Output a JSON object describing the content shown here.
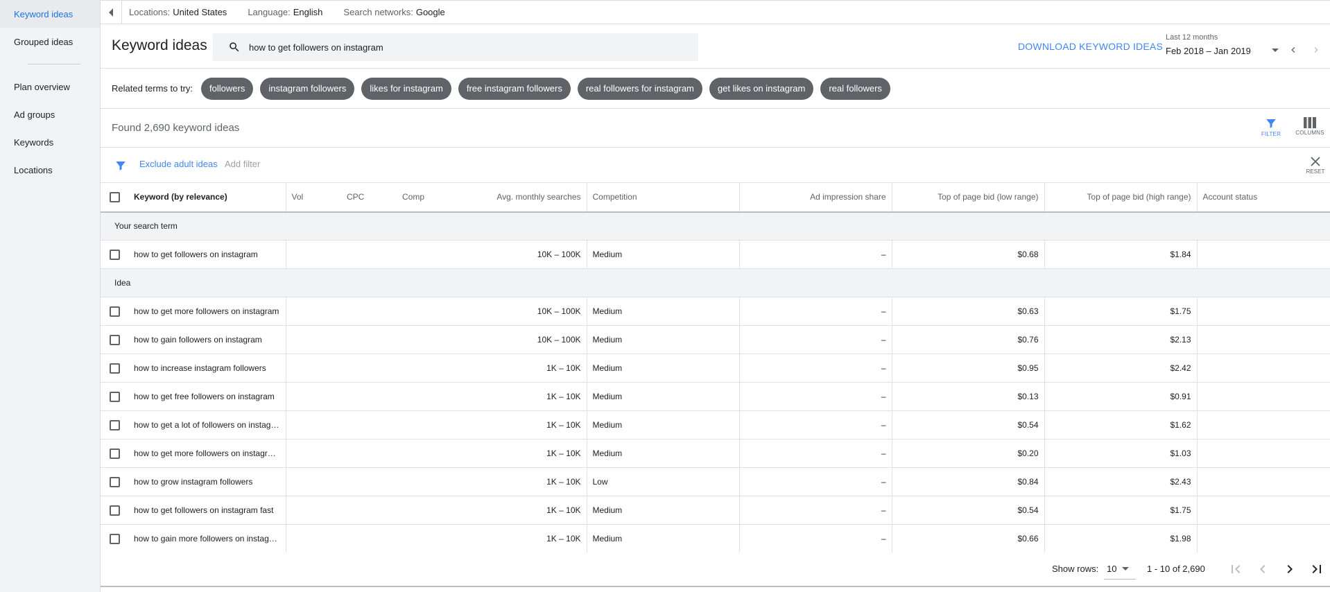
{
  "sidebar": {
    "items": [
      {
        "label": "Keyword ideas",
        "active": true
      },
      {
        "label": "Grouped ideas",
        "active": false
      },
      {
        "label": "Plan overview",
        "active": false
      },
      {
        "label": "Ad groups",
        "active": false
      },
      {
        "label": "Keywords",
        "active": false
      },
      {
        "label": "Locations",
        "active": false
      }
    ]
  },
  "topbar": {
    "locations_label": "Locations:",
    "locations_value": "United States",
    "language_label": "Language:",
    "language_value": "English",
    "networks_label": "Search networks:",
    "networks_value": "Google"
  },
  "header": {
    "title": "Keyword ideas",
    "search_value": "how to get followers on instagram",
    "download_label": "DOWNLOAD KEYWORD IDEAS",
    "date_range_label": "Last 12 months",
    "date_range_value": "Feb 2018 – Jan 2019"
  },
  "related": {
    "label": "Related terms to try:",
    "chips": [
      "followers",
      "instagram followers",
      "likes for instagram",
      "free instagram followers",
      "real followers for instagram",
      "get likes on instagram",
      "real followers"
    ]
  },
  "results": {
    "found_text": "Found 2,690 keyword ideas",
    "filter_label": "FILTER",
    "columns_label": "COLUMNS",
    "exclude_label": "Exclude adult ideas",
    "add_filter_label": "Add filter",
    "reset_label": "RESET"
  },
  "table": {
    "headers": {
      "keyword": "Keyword (by relevance)",
      "vol": "Vol",
      "cpc": "CPC",
      "comp": "Comp",
      "avg": "Avg. monthly searches",
      "competition": "Competition",
      "impression": "Ad impression share",
      "low_bid": "Top of page bid (low range)",
      "high_bid": "Top of page bid (high range)",
      "status": "Account status"
    },
    "section_search_term": "Your search term",
    "section_idea": "Idea",
    "search_term_row": {
      "keyword": "how to get followers on instagram",
      "avg": "10K – 100K",
      "competition": "Medium",
      "impression": "–",
      "low": "$0.68",
      "high": "$1.84"
    },
    "rows": [
      {
        "keyword": "how to get more followers on instagram",
        "avg": "10K – 100K",
        "competition": "Medium",
        "impression": "–",
        "low": "$0.63",
        "high": "$1.75"
      },
      {
        "keyword": "how to gain followers on instagram",
        "avg": "10K – 100K",
        "competition": "Medium",
        "impression": "–",
        "low": "$0.76",
        "high": "$2.13"
      },
      {
        "keyword": "how to increase instagram followers",
        "avg": "1K – 10K",
        "competition": "Medium",
        "impression": "–",
        "low": "$0.95",
        "high": "$2.42"
      },
      {
        "keyword": "how to get free followers on instagram",
        "avg": "1K – 10K",
        "competition": "Medium",
        "impression": "–",
        "low": "$0.13",
        "high": "$0.91"
      },
      {
        "keyword": "how to get a lot of followers on instagram",
        "avg": "1K – 10K",
        "competition": "Medium",
        "impression": "–",
        "low": "$0.54",
        "high": "$1.62"
      },
      {
        "keyword": "how to get more followers on instagram fast",
        "avg": "1K – 10K",
        "competition": "Medium",
        "impression": "–",
        "low": "$0.20",
        "high": "$1.03"
      },
      {
        "keyword": "how to grow instagram followers",
        "avg": "1K – 10K",
        "competition": "Low",
        "impression": "–",
        "low": "$0.84",
        "high": "$2.43"
      },
      {
        "keyword": "how to get followers on instagram fast",
        "avg": "1K – 10K",
        "competition": "Medium",
        "impression": "–",
        "low": "$0.54",
        "high": "$1.75"
      },
      {
        "keyword": "how to gain more followers on instagram",
        "avg": "1K – 10K",
        "competition": "Medium",
        "impression": "–",
        "low": "$0.66",
        "high": "$1.98"
      }
    ]
  },
  "footer": {
    "show_rows_label": "Show rows:",
    "rows_value": "10",
    "page_info": "1 - 10 of 2,690"
  },
  "colors": {
    "accent": "#4285f4",
    "chip": "#5f6368",
    "sidebar_bg": "#f1f3f4"
  },
  "icons": [
    "collapse-left-icon",
    "search-icon",
    "dropdown-arrow-icon",
    "chevron-left-icon",
    "chevron-right-icon",
    "filter-icon",
    "columns-icon",
    "close-icon",
    "first-page-icon",
    "last-page-icon"
  ]
}
